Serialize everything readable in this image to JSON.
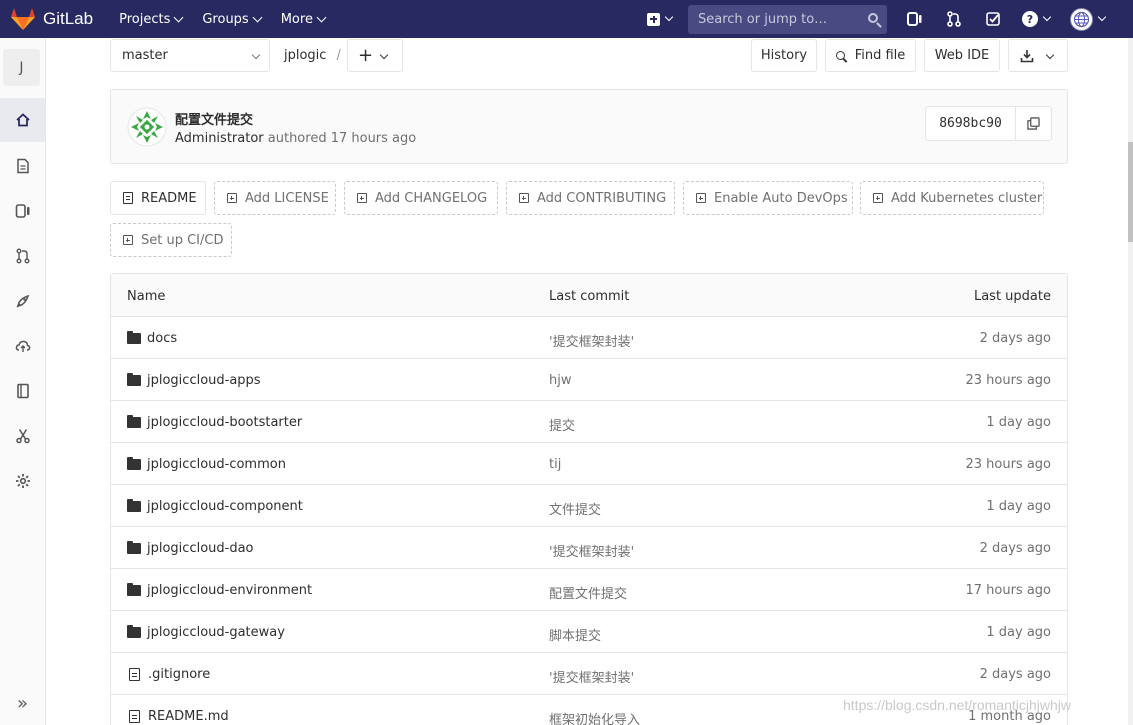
{
  "navbar": {
    "brand": "GitLab",
    "menu": [
      {
        "label": "Projects"
      },
      {
        "label": "Groups"
      },
      {
        "label": "More"
      }
    ],
    "search_placeholder": "Search or jump to…",
    "accent": "#292961"
  },
  "sidebar": {
    "project_initial": "J",
    "items": [
      {
        "icon": "home-icon"
      },
      {
        "icon": "document-icon"
      },
      {
        "icon": "issues-icon"
      },
      {
        "icon": "merge-request-icon"
      },
      {
        "icon": "rocket-icon"
      },
      {
        "icon": "cloud-icon"
      },
      {
        "icon": "book-icon"
      },
      {
        "icon": "scissors-icon"
      },
      {
        "icon": "gear-icon"
      }
    ],
    "collapse_label": "»"
  },
  "toolbar": {
    "branch": "master",
    "path_root": "jplogic",
    "path_sep": "/",
    "add_label": "+",
    "history": "History",
    "find_file": "Find file",
    "web_ide": "Web IDE"
  },
  "commit": {
    "title": "配置文件提交",
    "author": "Administrator",
    "authored": "authored 17 hours ago",
    "sha": "8698bc90"
  },
  "actions": {
    "readme": "README",
    "add_license": "Add LICENSE",
    "add_changelog": "Add CHANGELOG",
    "add_contributing": "Add CONTRIBUTING",
    "enable_devops": "Enable Auto DevOps",
    "add_k8s": "Add Kubernetes cluster",
    "setup_ci": "Set up CI/CD"
  },
  "tree": {
    "columns": {
      "name": "Name",
      "last_commit": "Last commit",
      "last_update": "Last update"
    },
    "rows": [
      {
        "type": "folder",
        "name": "docs",
        "commit": "'提交框架封装'",
        "update": "2 days ago"
      },
      {
        "type": "folder",
        "name": "jplogiccloud-apps",
        "commit": "hjw",
        "update": "23 hours ago"
      },
      {
        "type": "folder",
        "name": "jplogiccloud-bootstarter",
        "commit": "提交",
        "update": "1 day ago"
      },
      {
        "type": "folder",
        "name": "jplogiccloud-common",
        "commit": "tij",
        "update": "23 hours ago"
      },
      {
        "type": "folder",
        "name": "jplogiccloud-component",
        "commit": "文件提交",
        "update": "1 day ago"
      },
      {
        "type": "folder",
        "name": "jplogiccloud-dao",
        "commit": "'提交框架封装'",
        "update": "2 days ago"
      },
      {
        "type": "folder",
        "name": "jplogiccloud-environment",
        "commit": "配置文件提交",
        "update": "17 hours ago"
      },
      {
        "type": "folder",
        "name": "jplogiccloud-gateway",
        "commit": "脚本提交",
        "update": "1 day ago"
      },
      {
        "type": "file",
        "name": ".gitignore",
        "commit": "'提交框架封装'",
        "update": "2 days ago"
      },
      {
        "type": "file",
        "name": "README.md",
        "commit": "框架初始化导入",
        "update": "1 month ago"
      }
    ]
  },
  "watermark": "https://blog.csdn.net/romanticjhjwhjw"
}
